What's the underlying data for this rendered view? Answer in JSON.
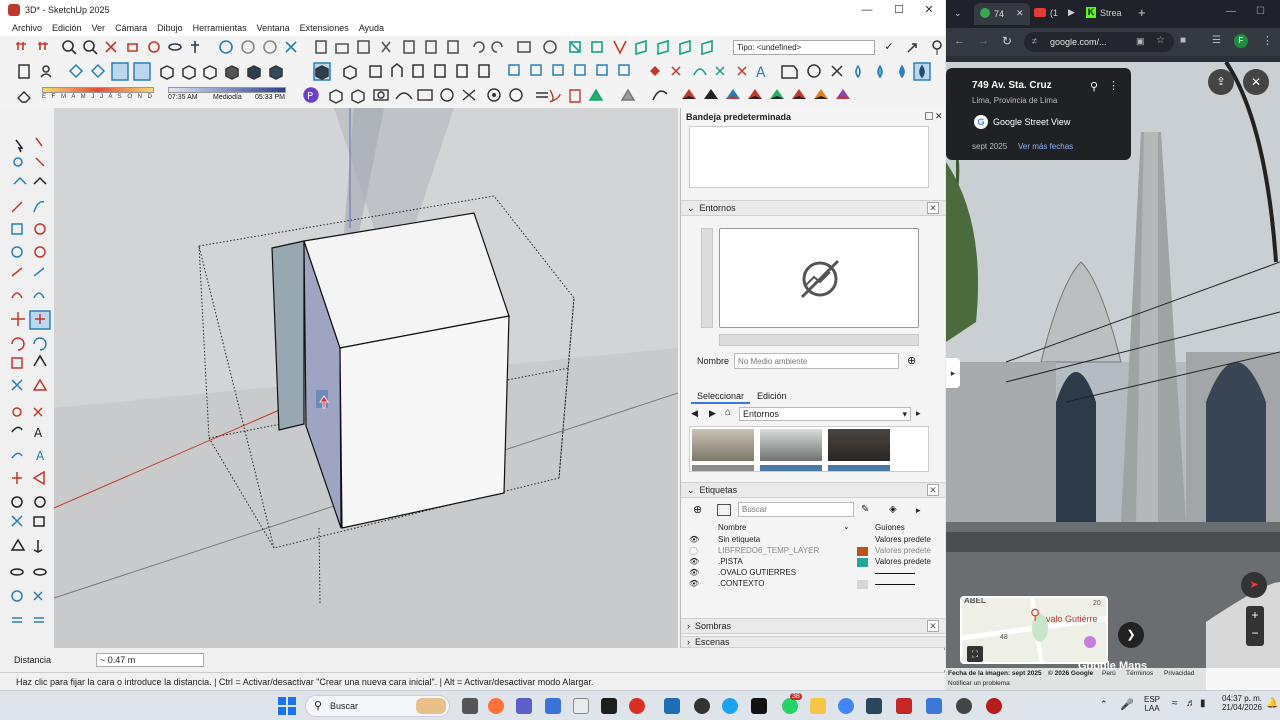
{
  "sketchup": {
    "title": "3D* - SketchUp 2025",
    "menu": [
      "Archivo",
      "Edición",
      "Ver",
      "Cámara",
      "Dibujo",
      "Herramientas",
      "Ventana",
      "Extensiones",
      "Ayuda"
    ],
    "tag_select": "Tipo: <undefined>",
    "shadow_months": "E F M A M J J A S O N D",
    "time_start": "07:35 AM",
    "time_mid": "Mediodía",
    "time_end": "05:33 PM",
    "tray_title": "Bandeja predeterminada",
    "environments": {
      "header": "Entornos",
      "name_label": "Nombre",
      "name_placeholder": "No Medio ambiente",
      "tab_select": "Seleccionar",
      "tab_edit": "Edición",
      "dropdown": "Entornos"
    },
    "tags": {
      "header": "Etiquetas",
      "search_placeholder": "Buscar",
      "col_name": "Nombre",
      "col_dash": "Guiones",
      "rows": [
        {
          "name": "Sin etiqueta",
          "dash": "Valores predete",
          "color": "",
          "visible": true
        },
        {
          "name": "LIBFREDO6_TEMP_LAYER",
          "dash": "Valores predete",
          "color": "#c0521e",
          "visible": false
        },
        {
          "name": ".PISTA",
          "dash": "Valores predete",
          "color": "#26a69a",
          "visible": true
        },
        {
          "name": ".OVALO GUTIERRES",
          "dash": "",
          "color": "",
          "visible": true
        },
        {
          "name": ".CONTEXTO",
          "dash": "",
          "color": "#d6d6d6",
          "visible": true
        }
      ]
    },
    "shadows_header": "Sombras",
    "scenes_header": "Escenas",
    "measure_label": "Distancia",
    "measure_value": "~ 0.47 m",
    "status_hint": "Haz clic para fijar la cara o introduce la distancia. | Ctrl = Activar/desactivar \"Crear una nueva cara inicial\". | Alt = Activar/desactivar modo Alargar."
  },
  "chrome": {
    "tabs": [
      "74",
      "(1",
      "Strea"
    ],
    "url": "google.com/...",
    "profile": "F",
    "place_title": "749 Av. Sta. Cruz",
    "place_subtitle": "Lima, Provincia de Lima",
    "street_view": "Google Street View",
    "date": "sept 2025",
    "more_dates": "Ver más fechas",
    "minimap_label": "valo Gutiérre",
    "minimap_num_a": "20",
    "minimap_num_b": "48",
    "minimap_top": "ABEL",
    "footer_image_date": "Fecha de la imagen: sept 2025",
    "footer_copyright": "© 2026 Google",
    "footer_country": "Perú",
    "footer_terms": "Términos",
    "footer_privacy": "Privacidad",
    "footer_report": "Notificar un problema",
    "google_watermark": "Google Maps"
  },
  "taskbar": {
    "search": "Buscar",
    "lang_top": "ESP",
    "lang_bottom": "LAA",
    "time": "04:37 p. m.",
    "date": "21/04/2026",
    "badge": "38"
  }
}
